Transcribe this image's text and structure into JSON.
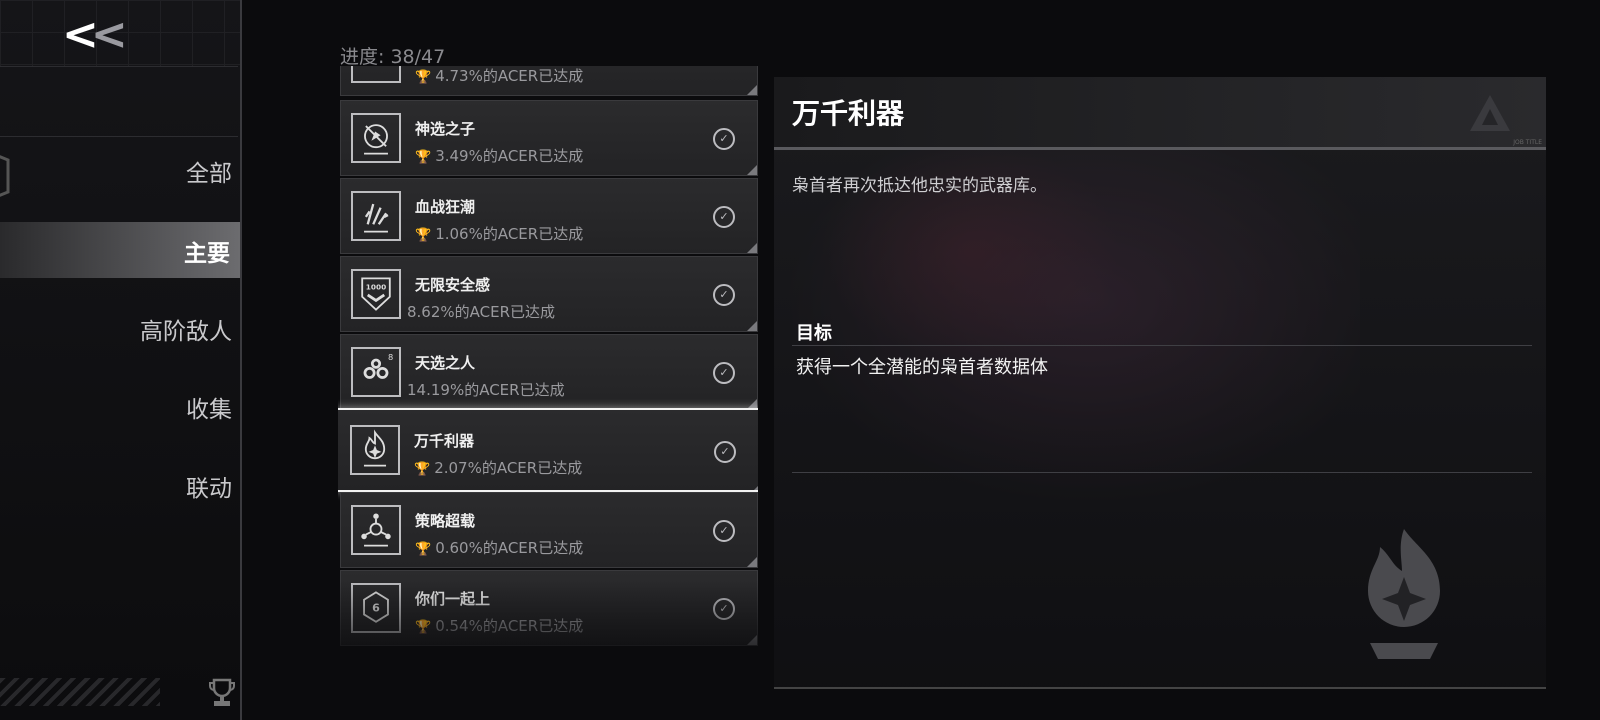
{
  "sidebar": {
    "back_label": "<<",
    "categories": [
      {
        "label": "全部"
      },
      {
        "label": "主要"
      },
      {
        "label": "高阶敌人"
      },
      {
        "label": "收集"
      },
      {
        "label": "联动"
      }
    ],
    "active_index": 1
  },
  "progress": "进度: 38/47",
  "achievements": [
    {
      "name": "",
      "rate": "4.73%的ACER已达成",
      "icon": "partial-icon",
      "completed": true
    },
    {
      "name": "神选之子",
      "rate": "3.49%的ACER已达成",
      "icon": "compass-slash-icon",
      "completed": true
    },
    {
      "name": "血战狂潮",
      "rate": "1.06%的ACER已达成",
      "icon": "claw-icon",
      "completed": true
    },
    {
      "name": "无限安全感",
      "rate": "8.62%的ACER已达成",
      "icon": "shield-1000-icon",
      "completed": true
    },
    {
      "name": "天选之人",
      "rate": "14.19%的ACER已达成",
      "icon": "gears-8-icon",
      "completed": true
    },
    {
      "name": "万千利器",
      "rate": "2.07%的ACER已达成",
      "icon": "flame-star-icon",
      "completed": true,
      "selected": true
    },
    {
      "name": "策略超载",
      "rate": "0.60%的ACER已达成",
      "icon": "network-icon",
      "completed": true
    },
    {
      "name": "你们一起上",
      "rate": "0.54%的ACER已达成",
      "icon": "hex-6-icon",
      "completed": true
    }
  ],
  "detail": {
    "title": "万千利器",
    "description": "枭首者再次抵达他忠实的武器库。",
    "goal_label": "目标",
    "goal_text": "获得一个全潜能的枭首者数据体",
    "logo_caption": "JOB TITLE",
    "icon": "flame-star-icon"
  },
  "colors": {
    "accent": "#ffffff",
    "background": "#0b0b0d",
    "selected_border": "#f2f2f2"
  }
}
